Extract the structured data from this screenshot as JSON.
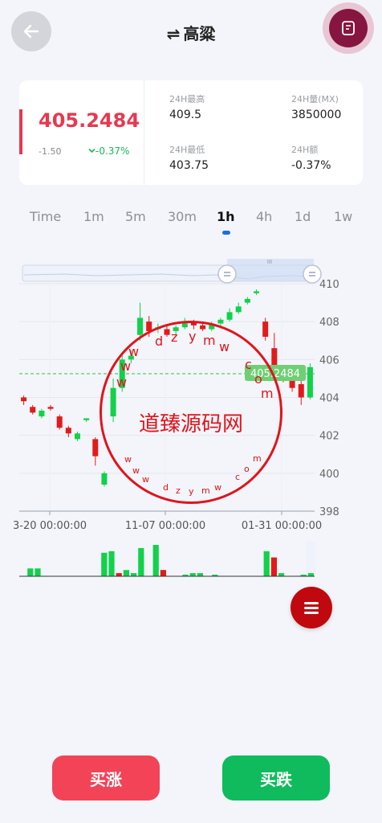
{
  "header": {
    "title": "高粱",
    "swap_glyph": "⇌"
  },
  "ticker": {
    "price": "405.2484",
    "change": "-1.50",
    "percent": "-0.37%",
    "stats": [
      {
        "label": "24H最高",
        "value": "409.5"
      },
      {
        "label": "24H量(MX)",
        "value": "3850000"
      },
      {
        "label": "24H最低",
        "value": "403.75"
      },
      {
        "label": "24H额",
        "value": "-0.37%"
      }
    ]
  },
  "tabs": [
    "Time",
    "1m",
    "5m",
    "30m",
    "1h",
    "4h",
    "1d",
    "1w"
  ],
  "active_tab": "1h",
  "chart_data": {
    "type": "candlestick",
    "price_axis": [
      "410",
      "408",
      "406",
      "404",
      "402",
      "400",
      "398"
    ],
    "ylim": [
      398,
      410
    ],
    "time_labels": [
      "3-20 00:00:00",
      "11-07 00:00:00",
      "01-31 00:00:00"
    ],
    "current_price_label": "405.2484",
    "current_price": 405.25,
    "candles": [
      {
        "o": 404.0,
        "c": 403.8,
        "h": 404.1,
        "l": 403.6
      },
      {
        "o": 403.5,
        "c": 403.2,
        "h": 403.6,
        "l": 403.1
      },
      {
        "o": 403.0,
        "c": 403.3,
        "h": 403.4,
        "l": 402.9
      },
      {
        "o": 403.5,
        "c": 403.4,
        "h": 403.6,
        "l": 403.3
      },
      {
        "o": 403.0,
        "c": 402.4,
        "h": 403.1,
        "l": 402.3
      },
      {
        "o": 402.4,
        "c": 402.1,
        "h": 402.5,
        "l": 401.9
      },
      {
        "o": 401.8,
        "c": 402.1,
        "h": 402.2,
        "l": 401.7
      },
      {
        "o": 402.8,
        "c": 402.9,
        "h": 402.9,
        "l": 402.7
      },
      {
        "o": 401.8,
        "c": 400.9,
        "h": 401.9,
        "l": 400.4
      },
      {
        "o": 399.4,
        "c": 400.0,
        "h": 400.1,
        "l": 399.3
      },
      {
        "o": 403.0,
        "c": 404.5,
        "h": 405.0,
        "l": 402.7
      },
      {
        "o": 404.5,
        "c": 406.0,
        "h": 406.3,
        "l": 404.3
      },
      {
        "o": 406.0,
        "c": 406.2,
        "h": 406.5,
        "l": 405.8
      },
      {
        "o": 407.3,
        "c": 408.2,
        "h": 409.0,
        "l": 407.0
      },
      {
        "o": 408.0,
        "c": 407.5,
        "h": 408.3,
        "l": 407.2
      },
      {
        "o": 407.6,
        "c": 407.7,
        "h": 407.9,
        "l": 407.4
      },
      {
        "o": 407.6,
        "c": 407.3,
        "h": 407.8,
        "l": 407.2
      },
      {
        "o": 407.5,
        "c": 407.7,
        "h": 407.8,
        "l": 407.3
      },
      {
        "o": 407.7,
        "c": 408.0,
        "h": 408.2,
        "l": 407.6
      },
      {
        "o": 408.0,
        "c": 407.8,
        "h": 408.1,
        "l": 407.6
      },
      {
        "o": 407.8,
        "c": 407.6,
        "h": 407.9,
        "l": 407.5
      },
      {
        "o": 407.6,
        "c": 407.9,
        "h": 408.0,
        "l": 407.5
      },
      {
        "o": 407.9,
        "c": 408.1,
        "h": 408.2,
        "l": 407.7
      },
      {
        "o": 408.1,
        "c": 408.5,
        "h": 408.7,
        "l": 408.0
      },
      {
        "o": 408.5,
        "c": 408.8,
        "h": 409.0,
        "l": 408.4
      },
      {
        "o": 409.0,
        "c": 409.2,
        "h": 409.3,
        "l": 408.9
      },
      {
        "o": 409.5,
        "c": 409.6,
        "h": 409.7,
        "l": 409.4
      },
      {
        "o": 408.0,
        "c": 407.2,
        "h": 408.2,
        "l": 407.0
      },
      {
        "o": 406.6,
        "c": 405.2,
        "h": 407.4,
        "l": 404.9
      },
      {
        "o": 405.2,
        "c": 405.0,
        "h": 405.3,
        "l": 404.8
      },
      {
        "o": 405.4,
        "c": 404.5,
        "h": 405.6,
        "l": 404.3
      },
      {
        "o": 404.7,
        "c": 404.0,
        "h": 404.9,
        "l": 403.6
      },
      {
        "o": 404.0,
        "c": 405.6,
        "h": 405.8,
        "l": 403.9
      }
    ],
    "volumes": [
      0,
      0.25,
      0.25,
      0,
      0,
      0,
      0,
      0,
      0,
      0,
      0,
      0.75,
      0.8,
      0.1,
      0.2,
      0.1,
      0.9,
      0,
      1.0,
      0.2,
      0,
      0,
      0.05,
      0.1,
      0.1,
      0,
      0.05,
      0,
      0,
      0,
      0,
      0,
      0,
      0.8,
      0.6,
      0.1,
      0,
      0,
      0.05,
      0.1
    ]
  },
  "watermark": {
    "text": "道臻源码网",
    "top_chars": [
      "w",
      "w",
      "w",
      "d",
      "z",
      "y",
      "m",
      "w",
      "c",
      "o",
      "m"
    ],
    "bottom_chars": [
      "w",
      "w",
      "w",
      "d",
      "z",
      "y",
      "m",
      "w",
      "c",
      "o",
      "m"
    ]
  },
  "buttons": {
    "buy": "买涨",
    "sell": "买跌"
  }
}
